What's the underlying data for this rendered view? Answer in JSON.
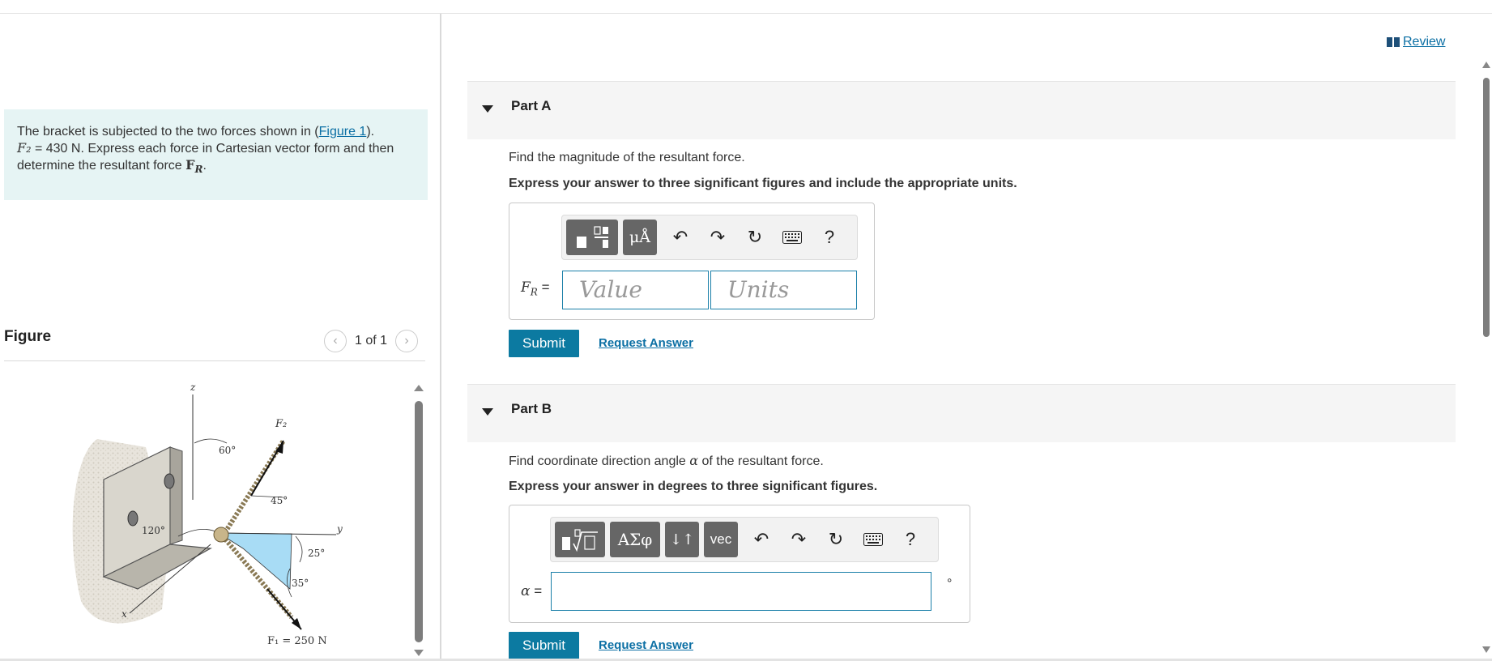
{
  "review": {
    "label": "Review"
  },
  "problem": {
    "part1": "The bracket is subjected to the two forces shown in (",
    "figure_link": "Figure 1",
    "part2": ").",
    "f2_symbol": "F₂",
    "f2_value": " = 430 N",
    "part3": ". Express each force in Cartesian vector form and then determine the resultant force ",
    "fr_symbol": "F",
    "fr_sub": "R",
    "part4": "."
  },
  "figure": {
    "title": "Figure",
    "pager": "1 of 1",
    "labels": {
      "z": "z",
      "f2": "F₂",
      "a60": "60°",
      "a45": "45°",
      "a120": "120°",
      "y": "y",
      "a25": "25°",
      "a35": "35°",
      "x": "x",
      "f1": "F₁ = 250 N"
    }
  },
  "partA": {
    "title": "Part A",
    "question": "Find the magnitude of the resultant force.",
    "instruction": "Express your answer to three significant figures and include the appropriate units.",
    "toolbar": {
      "units_btn": "μÅ",
      "help": "?"
    },
    "label_symbol": "F",
    "label_sub": "R",
    "label_eq": " =",
    "value_placeholder": "Value",
    "units_placeholder": "Units",
    "submit": "Submit",
    "request": "Request Answer"
  },
  "partB": {
    "title": "Part B",
    "question_pre": "Find coordinate direction angle ",
    "question_symbol": "α",
    "question_post": " of the resultant force.",
    "instruction": "Express your answer in degrees to three significant figures.",
    "toolbar": {
      "greek_btn": "ΑΣφ",
      "arrows_btn": "↓↑",
      "vec_btn": "vec",
      "help": "?"
    },
    "label_symbol": "α",
    "label_eq": " =",
    "degree": "°",
    "submit": "Submit",
    "request": "Request Answer"
  }
}
